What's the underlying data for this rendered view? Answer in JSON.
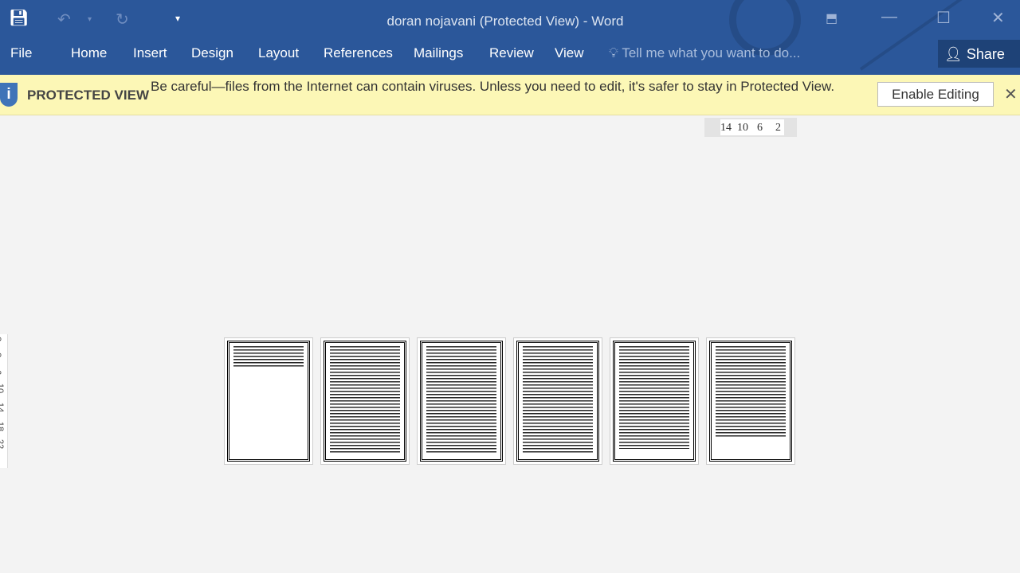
{
  "window": {
    "title": "doran nojavani (Protected View) - Word"
  },
  "qat": {
    "save_icon": "save-icon",
    "undo_icon": "undo-icon",
    "redo_icon": "redo-icon",
    "customize_icon": "customize-qat-icon"
  },
  "controls": {
    "ribbon_display": "ribbon-display-options-icon",
    "minimize": "minimize-icon",
    "maximize": "maximize-icon",
    "close": "close-icon"
  },
  "tabs": [
    "File",
    "Home",
    "Insert",
    "Design",
    "Layout",
    "References",
    "Mailings",
    "Review",
    "View"
  ],
  "tell_me": "Tell me what you want to do...",
  "share": "Share",
  "protected_view": {
    "title": "PROTECTED VIEW",
    "message": "Be careful—files from the Internet can contain viruses. Unless you need to edit, it's safer to stay in Protected View.",
    "button": "Enable Editing"
  },
  "ruler": {
    "labels": [
      "14",
      "10",
      "6",
      "2"
    ]
  },
  "vruler": {
    "labels": [
      "2",
      "2",
      "6",
      "10",
      "14",
      "18",
      "22"
    ]
  },
  "pages": [
    {
      "fill": 0.2
    },
    {
      "fill": 1
    },
    {
      "fill": 1
    },
    {
      "fill": 1
    },
    {
      "fill": 0.95
    },
    {
      "fill": 0.85
    }
  ]
}
